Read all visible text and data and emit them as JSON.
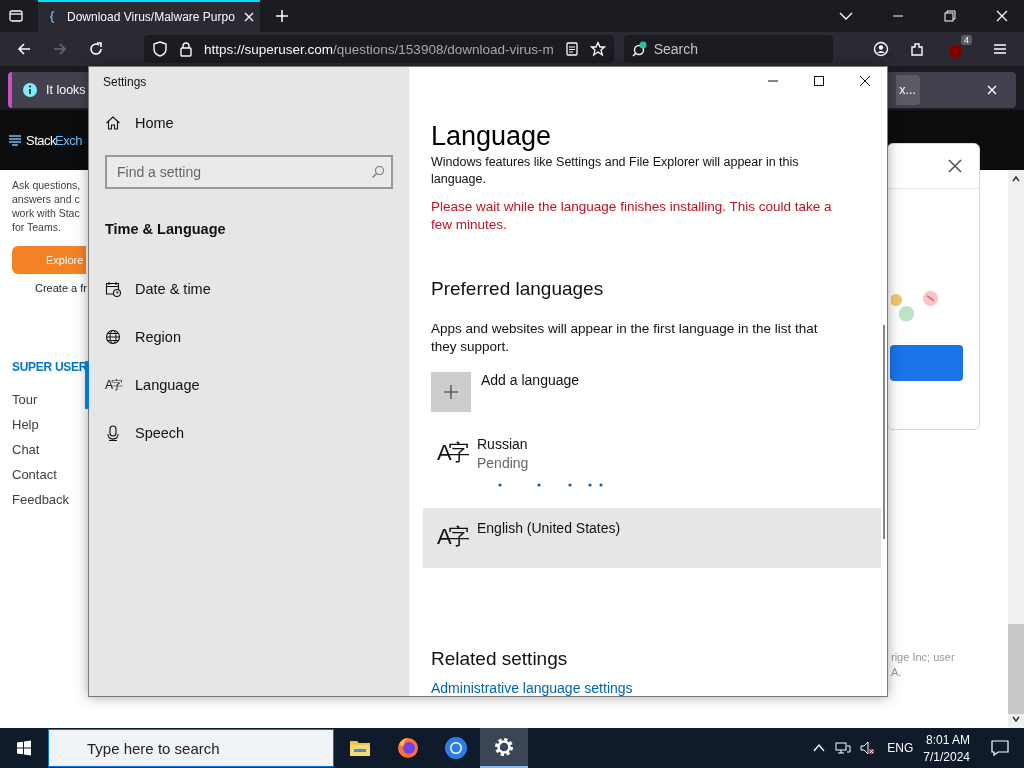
{
  "browser": {
    "tab": {
      "title": "Download Virus/Malware Purpo",
      "selected": true
    },
    "url": {
      "host": "https://superuser.com",
      "path": "/questions/153908/download-virus-m"
    },
    "search_placeholder": "Search",
    "extension_badge": "4",
    "notification": {
      "text": "It looks",
      "action": "x..."
    },
    "site": {
      "logo": "Stack",
      "logo_accent": "Exch",
      "intro_lines": [
        "Ask questions,",
        "answers and c",
        "work with Stac",
        "for Teams."
      ],
      "explore": "Explore",
      "create": "Create a fr",
      "section": "SUPER USER",
      "links": [
        "Tour",
        "Help",
        "Chat",
        "Contact",
        "Feedback"
      ],
      "footer_lines": [
        "rige Inc; user",
        "A."
      ]
    }
  },
  "settings": {
    "title": "Settings",
    "home": "Home",
    "search_placeholder": "Find a setting",
    "section": "Time & Language",
    "nav": [
      {
        "label": "Date & time",
        "kind": "calendar",
        "selected": false
      },
      {
        "label": "Region",
        "kind": "globe",
        "selected": false
      },
      {
        "label": "Language",
        "kind": "language",
        "glyph": "A字",
        "selected": true
      },
      {
        "label": "Speech",
        "kind": "microphone",
        "selected": false
      }
    ],
    "page": {
      "title": "Language",
      "intro": "Windows features like Settings and File Explorer will appear in this language.",
      "warning": "Please wait while the language finishes installing. This could take a few minutes.",
      "preferred_heading": "Preferred languages",
      "preferred_text": "Apps and websites will appear in the first language in the list that they support.",
      "add_label": "Add a language",
      "languages": [
        {
          "name": "Russian",
          "glyph": "A字",
          "status": "Pending",
          "installing": true,
          "selected": false
        },
        {
          "name": "English (United States)",
          "glyph": "A字",
          "installing": false,
          "selected": true
        }
      ],
      "related_heading": "Related settings",
      "related_link": "Administrative language settings"
    }
  },
  "taskbar": {
    "search_placeholder": "Type here to search",
    "apps": [
      {
        "kind": "folder",
        "selected": false
      },
      {
        "kind": "firefox",
        "selected": false
      },
      {
        "kind": "chrome",
        "selected": false
      },
      {
        "kind": "settings",
        "selected": true
      }
    ],
    "language": "ENG",
    "time": "8:01 AM",
    "date": "7/1/2024"
  }
}
